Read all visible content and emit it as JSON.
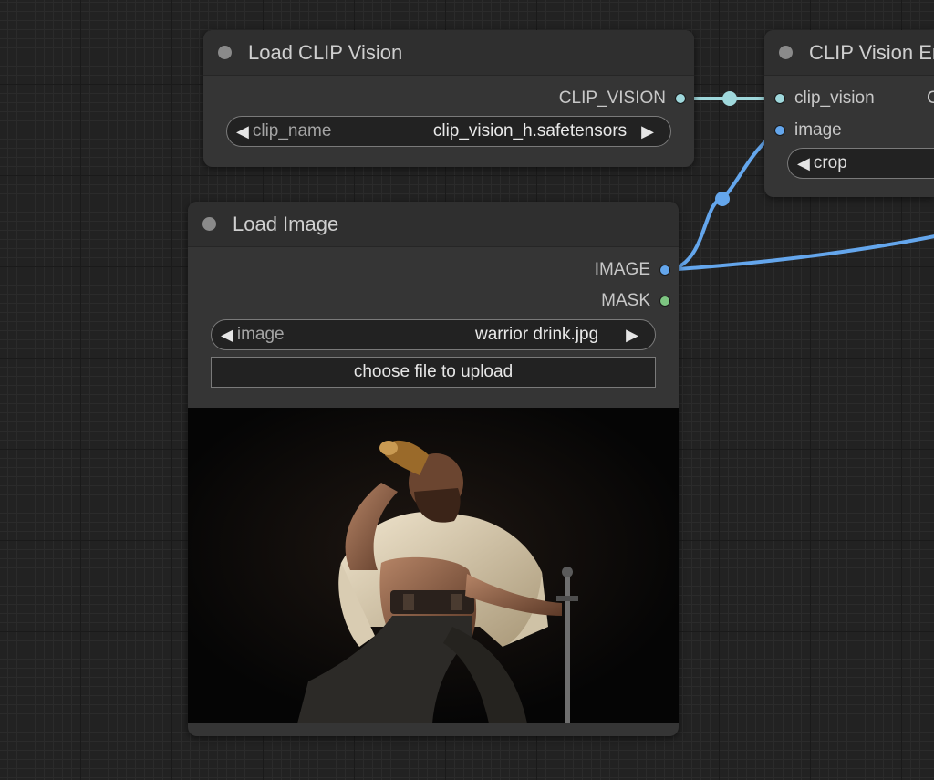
{
  "colors": {
    "clip_vision_link": "#9fd8dc",
    "image_link": "#64a6ec",
    "mask_slot": "#7dc581"
  },
  "nodes": {
    "load_clip_vision": {
      "title": "Load CLIP Vision",
      "output": "CLIP_VISION",
      "widget": {
        "label": "clip_name",
        "value": "clip_vision_h.safetensors"
      }
    },
    "clip_vision_encode": {
      "title": "CLIP Vision Encode",
      "inputs": [
        "clip_vision",
        "image"
      ],
      "output_initial": "C",
      "widget": {
        "label": "crop"
      }
    },
    "load_image": {
      "title": "Load Image",
      "outputs": [
        "IMAGE",
        "MASK"
      ],
      "widget": {
        "label": "image",
        "value": "warrior drink.jpg"
      },
      "upload_label": "choose file to upload",
      "preview_icon": "warrior-drinking-photo"
    }
  },
  "icons": {
    "arrow_left": "◀",
    "arrow_right": "▶"
  }
}
